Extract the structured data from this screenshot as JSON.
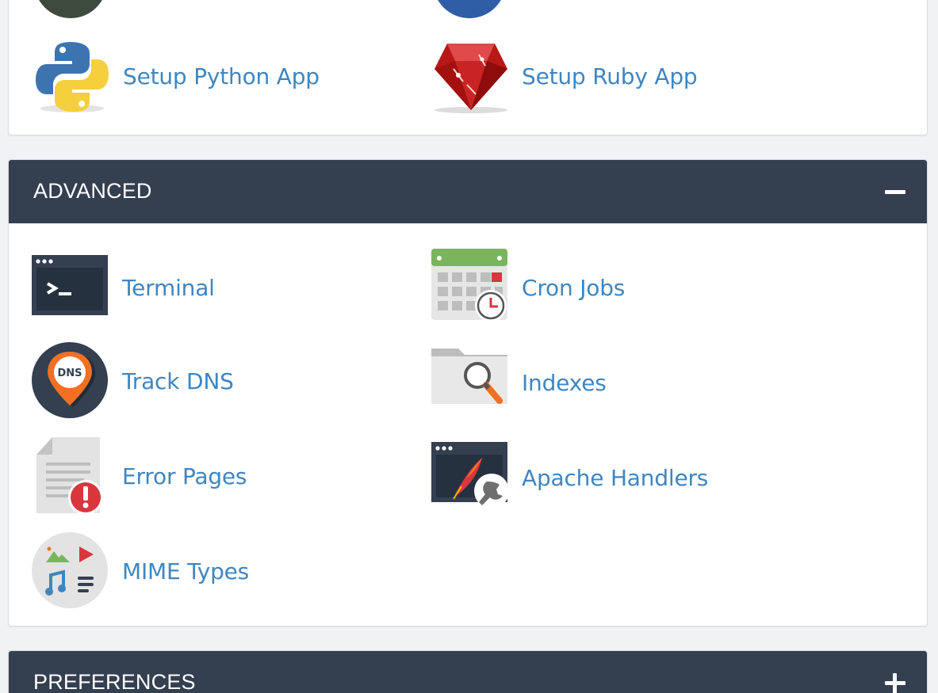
{
  "top_section": {
    "items": [
      {
        "label": "Setup Python App",
        "icon": "python-icon"
      },
      {
        "label": "Setup Ruby App",
        "icon": "ruby-icon"
      }
    ]
  },
  "advanced": {
    "title": "ADVANCED",
    "toggle": "collapse",
    "items": [
      {
        "label": "Terminal",
        "icon": "terminal-icon"
      },
      {
        "label": "Cron Jobs",
        "icon": "cron-calendar-icon"
      },
      {
        "label": "Track DNS",
        "icon": "dns-pin-icon"
      },
      {
        "label": "Indexes",
        "icon": "folder-search-icon"
      },
      {
        "label": "Error Pages",
        "icon": "error-document-icon"
      },
      {
        "label": "Apache Handlers",
        "icon": "apache-feather-icon"
      },
      {
        "label": "MIME Types",
        "icon": "mime-media-icon"
      }
    ]
  },
  "preferences": {
    "title": "PREFERENCES",
    "toggle": "expand"
  },
  "colors": {
    "header_bg": "#343f50",
    "link": "#3f86c0",
    "page_bg": "#f1f2f4"
  }
}
